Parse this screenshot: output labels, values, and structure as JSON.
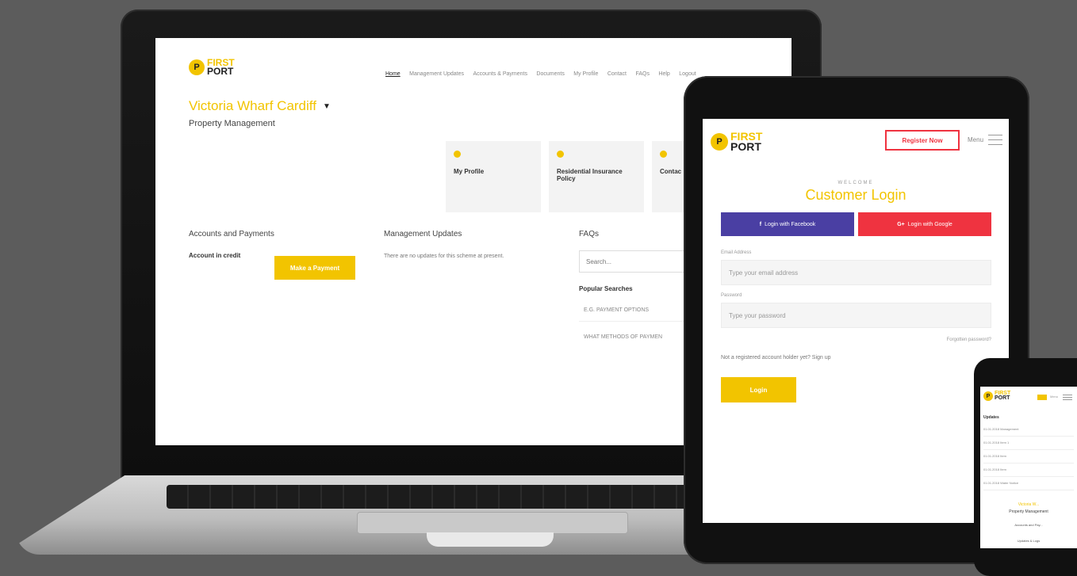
{
  "brand": {
    "logo_first": "FIRST",
    "logo_port": "PORT",
    "logo_glyph": "P",
    "accent_color": "#f2c400",
    "facebook_color": "#4a3fa3",
    "google_color": "#ef3340"
  },
  "laptop": {
    "nav": [
      "Home",
      "Management Updates",
      "Accounts & Payments",
      "Documents",
      "My Profile",
      "Contact",
      "FAQs",
      "Help",
      "Logout"
    ],
    "property_name": "Victoria Wharf Cardiff",
    "property_subtitle": "Property Management",
    "tiles": [
      "My Profile",
      "Residential Insurance Policy",
      "Contac"
    ],
    "accounts": {
      "title": "Accounts and Payments",
      "status": "Account in credit",
      "button": "Make a Payment"
    },
    "updates": {
      "title": "Management Updates",
      "text": "There are no updates for this scheme at present."
    },
    "faqs": {
      "title": "FAQs",
      "search_placeholder": "Search...",
      "popular_title": "Popular Searches",
      "items": [
        "E.G. PAYMENT OPTIONS",
        "WHAT METHODS OF PAYMEN"
      ]
    }
  },
  "tablet": {
    "register_button": "Register Now",
    "menu_label": "Menu",
    "welcome": "WELCOME",
    "title": "Customer Login",
    "facebook_button": "Login with Facebook",
    "google_button": "Login with Google",
    "email_label": "Email Address",
    "email_placeholder": "Type your email address",
    "password_label": "Password",
    "password_placeholder": "Type your password",
    "forgot": "Forgotten password?",
    "signup": "Not a registered account holder yet? Sign up",
    "login_button": "Login"
  },
  "phone": {
    "menu_label": "Menu",
    "section_title": "Updates",
    "rows": [
      "01.01.2018   Management",
      "01.01.2018   Item 1",
      "01.01.2018   Item",
      "01.01.2018   Item",
      "01.01.2018   Water Notice"
    ],
    "property_name": "Victoria W...",
    "property_subtitle": "Property Management",
    "link_accounts": "Accounts and Pay...",
    "link_updates": "Updates & Logs"
  }
}
